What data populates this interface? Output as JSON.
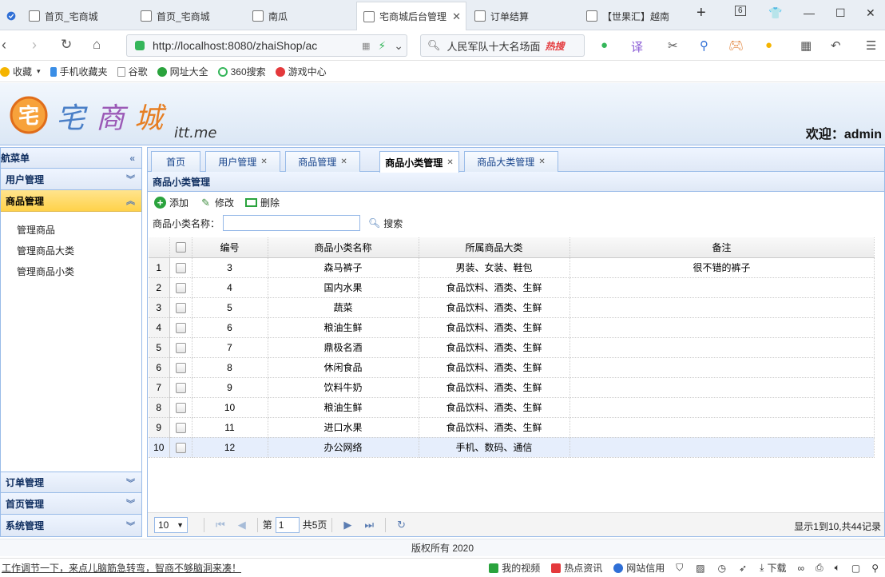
{
  "browser": {
    "tabs": [
      {
        "label": "首页_宅商城"
      },
      {
        "label": "首页_宅商城"
      },
      {
        "label": "南瓜"
      },
      {
        "label": "宅商城后台管理"
      },
      {
        "label": "订单结算"
      },
      {
        "label": "【世果汇】越南"
      }
    ],
    "tab_count": "6",
    "url": "http://localhost:8080/zhaiShop/ac",
    "search_text": "人民军队十大名场面",
    "hot_label": "热搜"
  },
  "bookmarks": [
    {
      "label": "收藏",
      "color": "#f5b400"
    },
    {
      "label": "手机收藏夹",
      "color": "#3a8ee6"
    },
    {
      "label": "谷歌",
      "color": "#999999"
    },
    {
      "label": "网址大全",
      "color": "#2aa33d"
    },
    {
      "label": "360搜索",
      "color": "#35b65a"
    },
    {
      "label": "游戏中心",
      "color": "#e4393c"
    }
  ],
  "header": {
    "logo_text": "宅商城",
    "logo_suffix": "itt.me",
    "welcome": "欢迎：admin"
  },
  "sidebar": {
    "title": "航菜单",
    "sections": [
      {
        "label": "用户管理"
      },
      {
        "label": "商品管理"
      }
    ],
    "sub_items": [
      {
        "label": "管理商品"
      },
      {
        "label": "管理商品大类"
      },
      {
        "label": "管理商品小类"
      }
    ],
    "bottom_sections": [
      {
        "label": "订单管理"
      },
      {
        "label": "首页管理"
      },
      {
        "label": "系统管理"
      }
    ]
  },
  "main": {
    "tabs": [
      {
        "label": "首页"
      },
      {
        "label": "用户管理"
      },
      {
        "label": "商品管理"
      },
      {
        "label": "商品小类管理"
      },
      {
        "label": "商品大类管理"
      }
    ],
    "panel_title": "商品小类管理",
    "toolbar": {
      "add": "添加",
      "edit": "修改",
      "delete": "删除"
    },
    "filter": {
      "label": "商品小类名称：",
      "value": "",
      "search": "搜索"
    },
    "table": {
      "columns": [
        "编号",
        "商品小类名称",
        "所属商品大类",
        "备注"
      ],
      "rows": [
        {
          "n": "1",
          "id": "3",
          "name": "森马裤子",
          "category": "男装、女装、鞋包",
          "note": "很不错的裤子"
        },
        {
          "n": "2",
          "id": "4",
          "name": "国内水果",
          "category": "食品饮料、酒类、生鲜",
          "note": ""
        },
        {
          "n": "3",
          "id": "5",
          "name": "蔬菜",
          "category": "食品饮料、酒类、生鲜",
          "note": ""
        },
        {
          "n": "4",
          "id": "6",
          "name": "粮油生鲜",
          "category": "食品饮料、酒类、生鲜",
          "note": ""
        },
        {
          "n": "5",
          "id": "7",
          "name": "鼎极名酒",
          "category": "食品饮料、酒类、生鲜",
          "note": ""
        },
        {
          "n": "6",
          "id": "8",
          "name": "休闲食品",
          "category": "食品饮料、酒类、生鲜",
          "note": ""
        },
        {
          "n": "7",
          "id": "9",
          "name": "饮料牛奶",
          "category": "食品饮料、酒类、生鲜",
          "note": ""
        },
        {
          "n": "8",
          "id": "10",
          "name": "粮油生鲜",
          "category": "食品饮料、酒类、生鲜",
          "note": ""
        },
        {
          "n": "9",
          "id": "11",
          "name": "进口水果",
          "category": "食品饮料、酒类、生鲜",
          "note": ""
        },
        {
          "n": "10",
          "id": "12",
          "name": "办公网络",
          "category": "手机、数码、通信",
          "note": ""
        }
      ]
    },
    "pager": {
      "page_size": "10",
      "page_prefix": "第",
      "page_value": "1",
      "page_suffix": "共5页",
      "info": "显示1到10,共44记录"
    }
  },
  "footer": {
    "copyright": "版权所有 2020"
  },
  "statusbar": {
    "news": "工作调节一下，来点儿脑筋急转弯，智商不够脑洞来凑！",
    "items": [
      {
        "label": "我的视频"
      },
      {
        "label": "热点资讯"
      },
      {
        "label": "网站信用"
      },
      {
        "label": "下载"
      }
    ]
  }
}
